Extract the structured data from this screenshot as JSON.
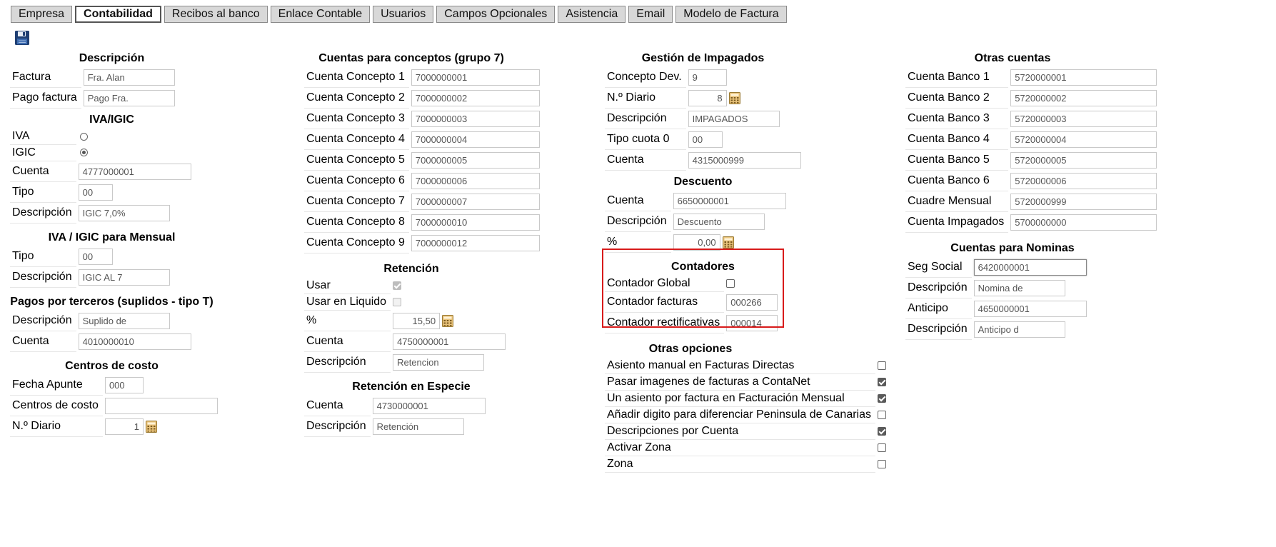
{
  "tabs": [
    {
      "label": "Empresa"
    },
    {
      "label": "Contabilidad"
    },
    {
      "label": "Recibos al banco"
    },
    {
      "label": "Enlace Contable"
    },
    {
      "label": "Usuarios"
    },
    {
      "label": "Campos Opcionales"
    },
    {
      "label": "Asistencia"
    },
    {
      "label": "Email"
    },
    {
      "label": "Modelo de Factura"
    }
  ],
  "active_tab": "Contabilidad",
  "col1": {
    "descripcion": {
      "title": "Descripción",
      "factura_label": "Factura",
      "factura_value": "Fra. Alan",
      "pago_label": "Pago factura",
      "pago_value": "Pago Fra."
    },
    "iva_igic": {
      "title": "IVA/IGIC",
      "iva_label": "IVA",
      "igic_label": "IGIC",
      "selected": "IGIC",
      "cuenta_label": "Cuenta",
      "cuenta_value": "4777000001",
      "tipo_label": "Tipo",
      "tipo_value": "00",
      "desc_label": "Descripción",
      "desc_value": "IGIC 7,0%"
    },
    "mensual": {
      "title": "IVA / IGIC para Mensual",
      "tipo_label": "Tipo",
      "tipo_value": "00",
      "desc_label": "Descripción",
      "desc_value": "IGIC AL 7"
    },
    "terceros": {
      "title": "Pagos por terceros (suplidos - tipo T)",
      "desc_label": "Descripción",
      "desc_value": "Suplido de",
      "cuenta_label": "Cuenta",
      "cuenta_value": "4010000010"
    },
    "centros": {
      "title": "Centros de costo",
      "fecha_label": "Fecha Apunte",
      "fecha_value": "000",
      "centros_label": "Centros de costo",
      "centros_value": "",
      "diario_label": "N.º Diario",
      "diario_value": "1"
    }
  },
  "col2": {
    "conceptos": {
      "title": "Cuentas para conceptos (grupo 7)",
      "rows": [
        {
          "label": "Cuenta Concepto 1",
          "value": "7000000001"
        },
        {
          "label": "Cuenta Concepto 2",
          "value": "7000000002"
        },
        {
          "label": "Cuenta Concepto 3",
          "value": "7000000003"
        },
        {
          "label": "Cuenta Concepto 4",
          "value": "7000000004"
        },
        {
          "label": "Cuenta Concepto 5",
          "value": "7000000005"
        },
        {
          "label": "Cuenta Concepto 6",
          "value": "7000000006"
        },
        {
          "label": "Cuenta Concepto 7",
          "value": "7000000007"
        },
        {
          "label": "Cuenta Concepto 8",
          "value": "7000000010"
        },
        {
          "label": "Cuenta Concepto 9",
          "value": "7000000012"
        }
      ]
    },
    "retencion": {
      "title": "Retención",
      "usar_label": "Usar",
      "usar_checked": true,
      "liquido_label": "Usar en Liquido",
      "liquido_checked": false,
      "pct_label": "%",
      "pct_value": "15,50",
      "cuenta_label": "Cuenta",
      "cuenta_value": "4750000001",
      "desc_label": "Descripción",
      "desc_value": "Retencion"
    },
    "especie": {
      "title": "Retención en Especie",
      "cuenta_label": "Cuenta",
      "cuenta_value": "4730000001",
      "desc_label": "Descripción",
      "desc_value": "Retención"
    }
  },
  "col3": {
    "impagados": {
      "title": "Gestión de Impagados",
      "concepto_label": "Concepto Dev.",
      "concepto_value": "9",
      "diario_label": "N.º Diario",
      "diario_value": "8",
      "desc_label": "Descripción",
      "desc_value": "IMPAGADOS",
      "tipo_label": "Tipo cuota 0",
      "tipo_value": "00",
      "cuenta_label": "Cuenta",
      "cuenta_value": "4315000999"
    },
    "descuento": {
      "title": "Descuento",
      "cuenta_label": "Cuenta",
      "cuenta_value": "6650000001",
      "desc_label": "Descripción",
      "desc_value": "Descuento",
      "pct_label": "%",
      "pct_value": "0,00"
    },
    "contadores": {
      "title": "Contadores",
      "global_label": "Contador Global",
      "global_checked": false,
      "facturas_label": "Contador facturas",
      "facturas_value": "000266",
      "rect_label": "Contador rectificativas",
      "rect_value": "000014"
    },
    "opciones": {
      "title": "Otras opciones",
      "rows": [
        {
          "label": "Asiento manual en Facturas Directas",
          "checked": false
        },
        {
          "label": "Pasar imagenes de facturas a ContaNet",
          "checked": true
        },
        {
          "label": "Un asiento por factura en Facturación Mensual",
          "checked": true
        },
        {
          "label": "Añadir digito para diferenciar Peninsula de Canarias",
          "checked": false
        },
        {
          "label": "Descripciones por Cuenta",
          "checked": true
        },
        {
          "label": "Activar Zona",
          "checked": false
        },
        {
          "label": "Zona",
          "checked": false
        }
      ]
    }
  },
  "col4": {
    "otras": {
      "title": "Otras cuentas",
      "rows": [
        {
          "label": "Cuenta Banco 1",
          "value": "5720000001"
        },
        {
          "label": "Cuenta Banco 2",
          "value": "5720000002"
        },
        {
          "label": "Cuenta Banco 3",
          "value": "5720000003"
        },
        {
          "label": "Cuenta Banco 4",
          "value": "5720000004"
        },
        {
          "label": "Cuenta Banco 5",
          "value": "5720000005"
        },
        {
          "label": "Cuenta Banco 6",
          "value": "5720000006"
        },
        {
          "label": "Cuadre Mensual",
          "value": "5720000999"
        },
        {
          "label": "Cuenta Impagados",
          "value": "5700000000"
        }
      ]
    },
    "nominas": {
      "title": "Cuentas para Nominas",
      "seg_label": "Seg Social",
      "seg_value": "6420000001",
      "desc1_label": "Descripción",
      "desc1_value": "Nomina de",
      "anticipo_label": "Anticipo",
      "anticipo_value": "4650000001",
      "desc2_label": "Descripción",
      "desc2_value": "Anticipo d"
    }
  },
  "icons": {
    "save": "floppy-disk-icon",
    "calculator": "calculator-icon"
  },
  "colors": {
    "highlight_box": "#d81b1b",
    "tab_bg": "#d8d8d8",
    "save_icon": "#1f3f73"
  }
}
